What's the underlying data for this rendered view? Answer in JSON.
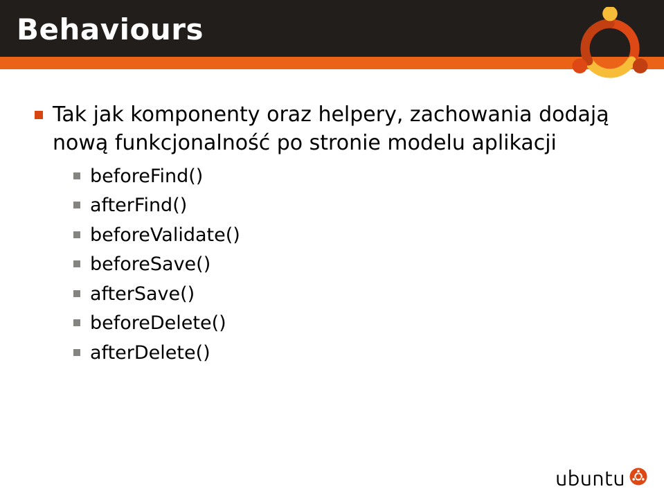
{
  "title": "Behaviours",
  "bullet1": "Tak jak komponenty oraz helpery, zachowania dodają nową funkcjonalność po stronie modelu aplikacji",
  "sub": {
    "a": "beforeFind()",
    "b": "afterFind()",
    "c": "beforeValidate()",
    "d": "beforeSave()",
    "e": "afterSave()",
    "f": "beforeDelete()",
    "g": "afterDelete()"
  },
  "footer_wordmark": "ubuntu"
}
